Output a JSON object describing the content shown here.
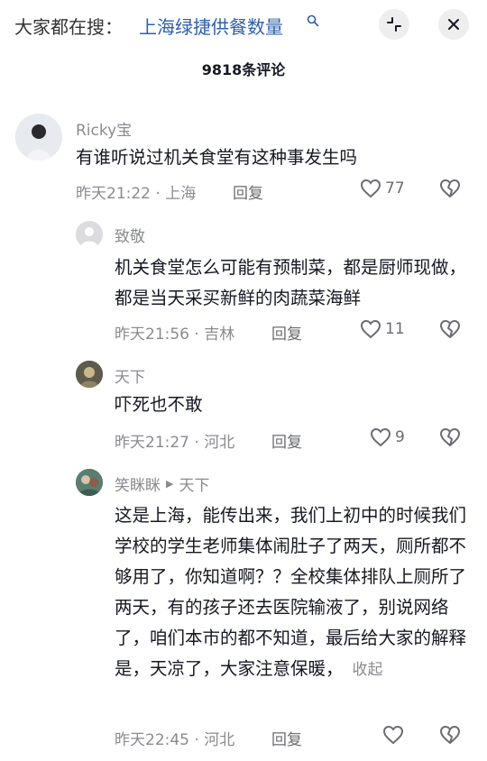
{
  "header": {
    "prefix": "大家都在搜：",
    "term": "上海绿捷供餐数量"
  },
  "comment_count": "9818条评论",
  "comments": [
    {
      "user": "Ricky宝",
      "text": "有谁听说过机关食堂有这种事发生吗",
      "time_loc": "昨天21:22 · 上海",
      "reply": "回复",
      "likes": "77"
    },
    {
      "user": "致敬",
      "text": "机关食堂怎么可能有预制菜，都是厨师现做，都是当天采买新鲜的肉蔬菜海鲜",
      "time_loc": "昨天21:56 · 吉林",
      "reply": "回复",
      "likes": "11"
    },
    {
      "user": "天下",
      "text": "吓死也不敢",
      "time_loc": "昨天21:27 · 河北",
      "reply": "回复",
      "likes": "9"
    },
    {
      "user": "笑眯眯",
      "reply_to": "天下",
      "text": "这是上海，能传出来，我们上初中的时候我们学校的学生老师集体闹肚子了两天，厕所都不够用了，你知道啊？？全校集体排队上厕所了两天，有的孩子还去医院输液了，别说网络了，咱们本市的都不知道，最后给大家的解释是，天凉了，大家注意保暖，",
      "collapse": "收起",
      "time_loc": "昨天22:45 · 河北",
      "reply": "回复",
      "likes": ""
    }
  ]
}
